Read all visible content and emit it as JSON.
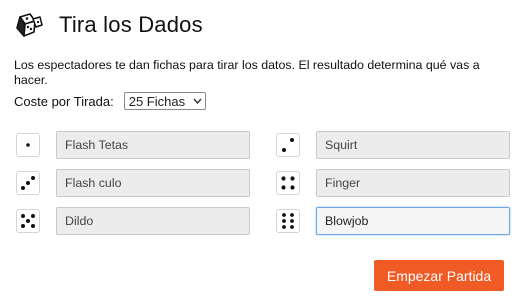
{
  "header": {
    "title": "Tira los Dados",
    "icon": "dice-icon"
  },
  "description": "Los espectadores te dan fichas para tirar los datos. El resultado determina qué vas a hacer.",
  "cost": {
    "label": "Coste por Tirada:",
    "selected": "25 Fichas"
  },
  "dice_options": [
    {
      "face": 1,
      "value": "Flash Tetas"
    },
    {
      "face": 2,
      "value": "Squirt"
    },
    {
      "face": 3,
      "value": "Flash culo"
    },
    {
      "face": 4,
      "value": "Finger"
    },
    {
      "face": 5,
      "value": "Dildo"
    },
    {
      "face": 6,
      "value": "Blowjob"
    }
  ],
  "start_button": {
    "label": "Empezar Partida"
  },
  "colors": {
    "accent": "#f05a24",
    "field_bg": "#ececec",
    "focus_border": "#6aa9e4"
  }
}
